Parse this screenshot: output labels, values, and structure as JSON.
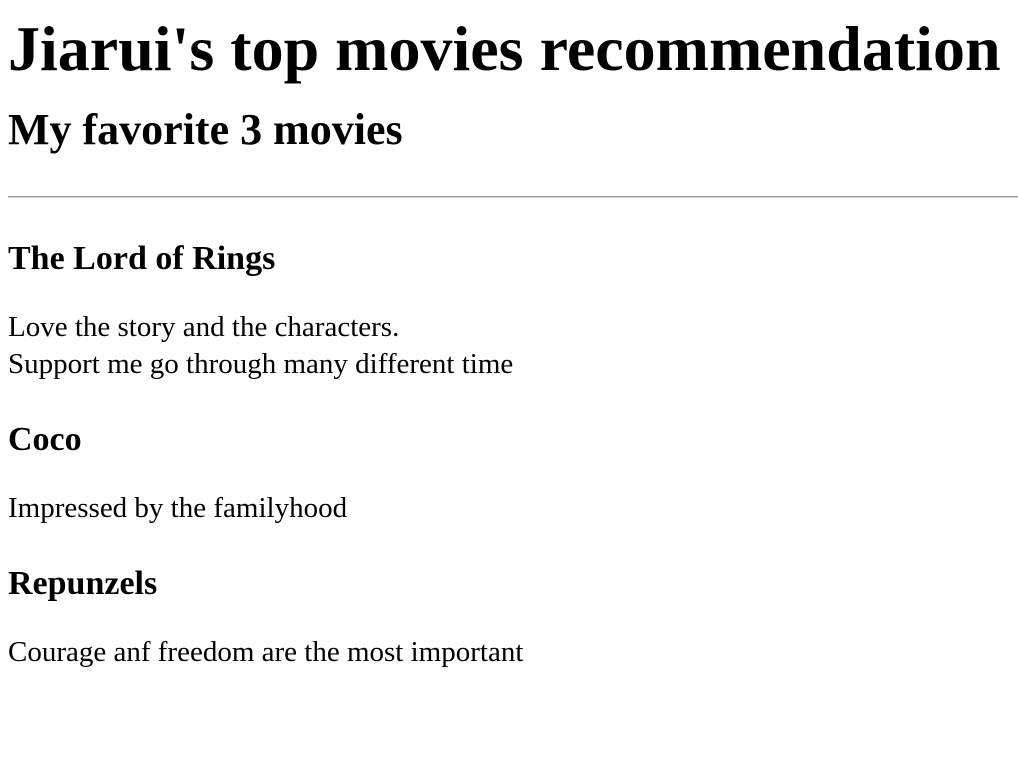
{
  "page": {
    "title": "Jiarui's top movies recommendation",
    "subtitle": "My favorite 3 movies"
  },
  "movies": [
    {
      "title": "The Lord of Rings",
      "lines": [
        "Love the story and the characters.",
        "Support me go through many different time"
      ]
    },
    {
      "title": "Coco",
      "lines": [
        "Impressed by the familyhood"
      ]
    },
    {
      "title": "Repunzels",
      "lines": [
        "Courage anf freedom are the most important"
      ]
    }
  ]
}
